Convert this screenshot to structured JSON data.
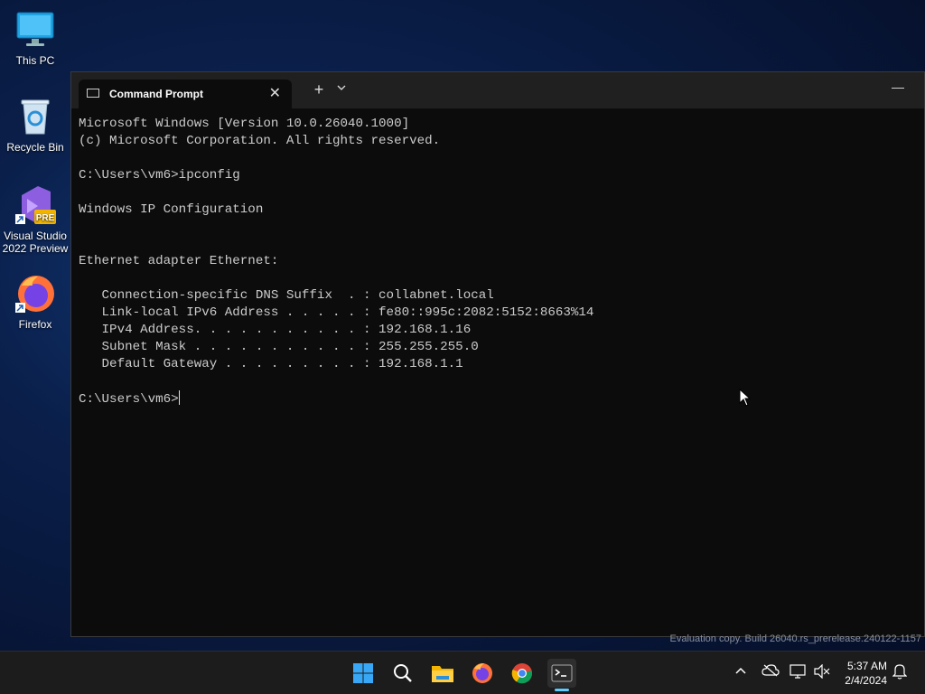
{
  "desktop": {
    "icons": [
      {
        "label": "This PC"
      },
      {
        "label": "Recycle Bin"
      },
      {
        "label": "Visual Studio 2022 Preview",
        "badge": "PRE"
      },
      {
        "label": "Firefox"
      }
    ]
  },
  "window": {
    "tab_title": "Command Prompt",
    "tab_close": "✕",
    "new_tab": "+",
    "dropdown": "⌄",
    "minimize": "—"
  },
  "console": {
    "output": "Microsoft Windows [Version 10.0.26040.1000]\n(c) Microsoft Corporation. All rights reserved.\n\nC:\\Users\\vm6>ipconfig\n\nWindows IP Configuration\n\n\nEthernet adapter Ethernet:\n\n   Connection-specific DNS Suffix  . : collabnet.local\n   Link-local IPv6 Address . . . . . : fe80::995c:2082:5152:8663%14\n   IPv4 Address. . . . . . . . . . . : 192.168.1.16\n   Subnet Mask . . . . . . . . . . . : 255.255.255.0\n   Default Gateway . . . . . . . . . : 192.168.1.1\n\n",
    "prompt": "C:\\Users\\vm6>"
  },
  "watermark": "Evaluation copy. Build 26040.rs_prerelease.240122-1157",
  "taskbar": {
    "apps": [
      "windows-start-icon",
      "search-icon",
      "file-explorer-icon",
      "firefox-icon",
      "chrome-icon",
      "terminal-icon"
    ],
    "clock_time": "5:37 AM",
    "clock_date": "2/4/2024"
  },
  "colors": {
    "accent": "#60cdff",
    "console_bg": "#0c0c0c",
    "console_text": "#cccccc",
    "taskbar_bg": "#1c1c1c"
  }
}
